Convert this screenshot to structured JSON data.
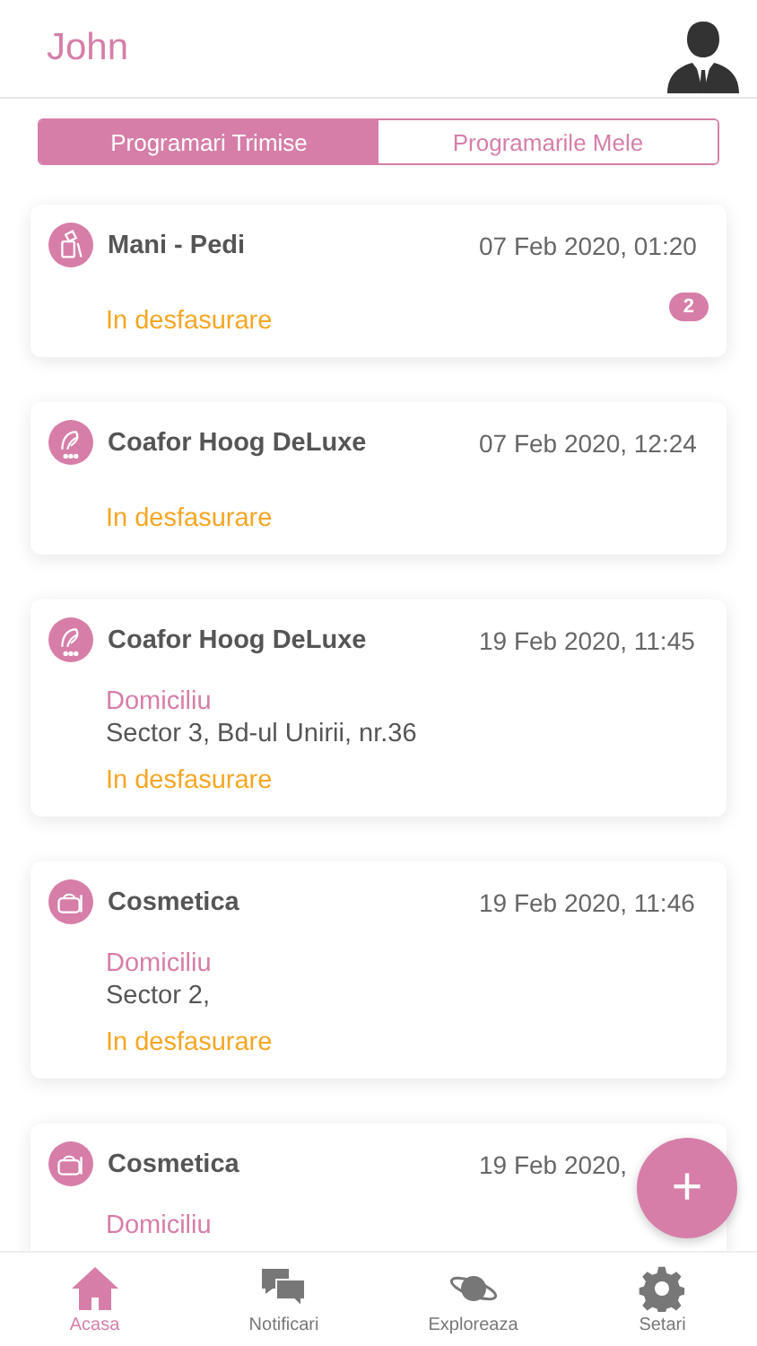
{
  "header": {
    "title": "John"
  },
  "tabs": [
    {
      "label": "Programari Trimise",
      "selected": true
    },
    {
      "label": "Programarile Mele",
      "selected": false
    }
  ],
  "appointments": [
    {
      "kind": "manicure",
      "title": "Mani - Pedi",
      "date": "07 Feb 2020, 01:20",
      "status": "In desfasurare",
      "badge": "2"
    },
    {
      "kind": "hair",
      "title": "Coafor Hoog DeLuxe",
      "date": "07 Feb 2020, 12:24",
      "status": "In desfasurare"
    },
    {
      "kind": "hair",
      "title": "Coafor Hoog DeLuxe",
      "date": "19 Feb 2020, 11:45",
      "location": "Domiciliu",
      "address": "Sector 3, Bd-ul Unirii, nr.36",
      "status": "In desfasurare"
    },
    {
      "kind": "cosmetics",
      "title": "Cosmetica",
      "date": "19 Feb 2020, 11:46",
      "location": "Domiciliu",
      "address": "Sector 2,",
      "status": "In desfasurare"
    },
    {
      "kind": "cosmetics",
      "title": "Cosmetica",
      "date": "19 Feb 2020,",
      "location": "Domiciliu"
    }
  ],
  "fab": {
    "label": "+"
  },
  "nav": [
    {
      "kind": "home",
      "label": "Acasa",
      "selected": true
    },
    {
      "kind": "chat",
      "label": "Notificari",
      "selected": false
    },
    {
      "kind": "planet",
      "label": "Exploreaza",
      "selected": false
    },
    {
      "kind": "gear",
      "label": "Setari",
      "selected": false
    }
  ]
}
